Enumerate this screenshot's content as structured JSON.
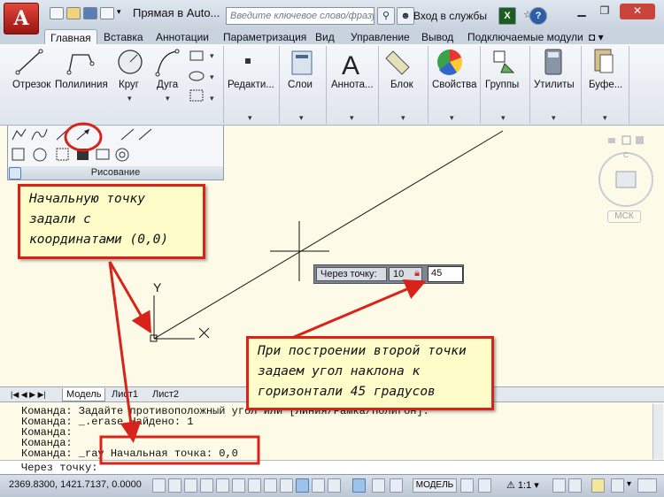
{
  "window": {
    "title": "Прямая в Auto...",
    "search_placeholder": "Введите ключевое слово/фразу",
    "signin": "Вход в службы",
    "app_letter": "A"
  },
  "ribbon": {
    "tabs": [
      "Главная",
      "Вставка",
      "Аннотации",
      "Параметризация",
      "Вид",
      "Управление",
      "Вывод",
      "Подключаемые модули"
    ],
    "draw_tools": [
      "Отрезок",
      "Полилиния",
      "Круг",
      "Дуга"
    ],
    "panels": [
      "Редакти...",
      "Слои",
      "Аннота...",
      "Блок",
      "Свойства",
      "Группы",
      "Утилиты",
      "Буфе..."
    ],
    "draw_panel_title": "Рисование"
  },
  "viewcube": {
    "mck": "МСК"
  },
  "axis": {
    "y": "Y",
    "x": "X"
  },
  "dynamic_input": {
    "label": "Через точку:",
    "value1": "10",
    "value2": "45"
  },
  "layout_tabs": [
    "Модель",
    "Лист1",
    "Лист2"
  ],
  "command_lines": [
    "Команда: Задайте противоположный угол или [Линия/Рамка/Полигон]:",
    "Команда: _.erase Найдено: 1",
    "Команда:",
    "Команда:",
    "Команда: _ray Начальная точка: 0,0"
  ],
  "prompt": "Через точку:",
  "status": {
    "coords": "2369.8300, 1421.7137, 0.0000",
    "model": "МОДЕЛЬ",
    "scale": "1:1"
  },
  "callouts": {
    "first": [
      "Начальную точку",
      "задали с",
      "координатами (0,0)"
    ],
    "second": [
      "При построении второй точки",
      "задаем угол наклона к",
      "горизонтали 45 градусов"
    ]
  },
  "colors": {
    "accent_red": "#d7231a",
    "callout_bg": "#fefcc8",
    "canvas_bg": "#fdfbe7"
  }
}
